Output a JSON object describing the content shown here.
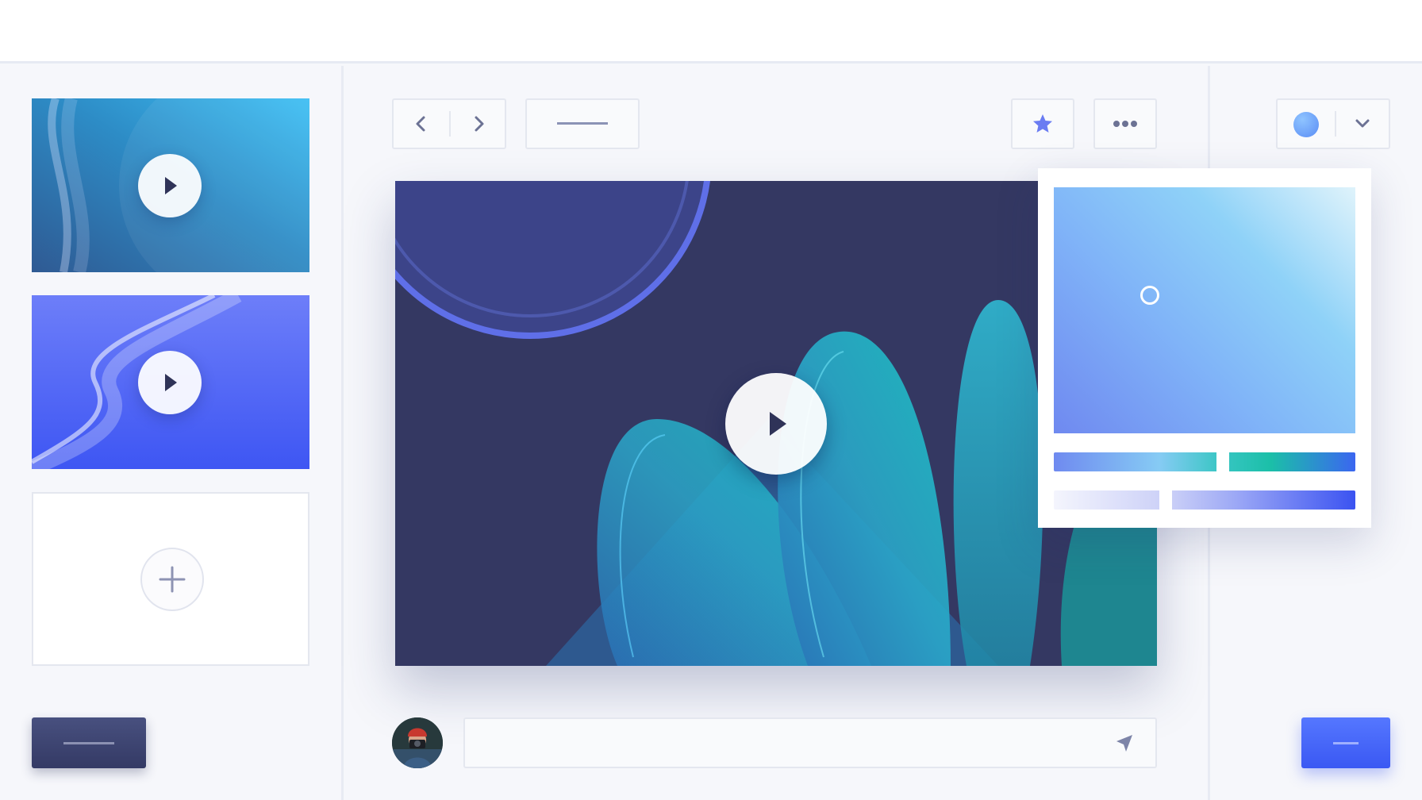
{
  "theme": {
    "accent": "#3f5bf4",
    "dark_button": "#3b4170",
    "background": "#f6f7fb",
    "video_background": "#343862"
  },
  "sidebar": {
    "items": [
      {
        "type": "video-thumbnail",
        "icon": "play-icon",
        "colors": [
          "#2e7fc0",
          "#3bbdf5"
        ]
      },
      {
        "type": "video-thumbnail",
        "icon": "play-icon",
        "colors": [
          "#6f7ef8",
          "#3f57f4"
        ]
      },
      {
        "type": "add-card",
        "icon": "plus-icon"
      }
    ],
    "footer_button": {
      "icon": "label-placeholder"
    }
  },
  "toolbar": {
    "nav": {
      "prev_icon": "chevron-left-icon",
      "next_icon": "chevron-right-icon"
    },
    "label_button": {
      "icon": "label-placeholder"
    },
    "favorite": {
      "icon": "star-icon",
      "color": "#6a7cf2"
    },
    "more": {
      "icon": "more-horizontal-icon"
    },
    "color_select": {
      "icon": "chevron-down-icon",
      "swatch": "#6ea6f8"
    }
  },
  "player": {
    "icon": "play-icon"
  },
  "color_picker": {
    "selected_color": "#7fa6f7",
    "hue_position": 0.56,
    "alpha_position": 0.37
  },
  "comment": {
    "avatar": "user-avatar",
    "input_value": "",
    "input_placeholder": "",
    "send_icon": "send-icon"
  },
  "footer": {
    "primary_button": {
      "icon": "label-placeholder"
    }
  }
}
